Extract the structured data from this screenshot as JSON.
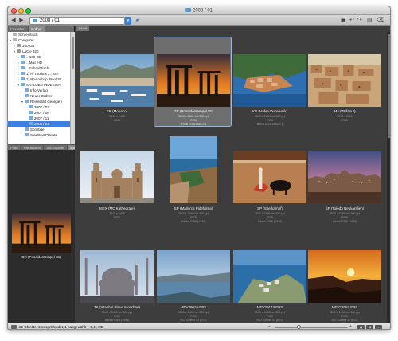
{
  "window": {
    "title": "2008 / 01"
  },
  "toolbar": {
    "path_value": "2008 / 01",
    "back_icon": "back-arrow-icon",
    "forward_icon": "forward-arrow-icon"
  },
  "sidebar": {
    "tabs": [
      "Favoriten",
      "Ordner"
    ],
    "tree": [
      {
        "label": "Schreibtisch",
        "level": 0,
        "icon": "desk",
        "tri": ""
      },
      {
        "label": "Computer",
        "level": 0,
        "icon": "desk",
        "tri": "▾"
      },
      {
        "label": "160 GB",
        "level": 1,
        "icon": "drive",
        "tri": "▸"
      },
      {
        "label": "LaCie 320",
        "level": 1,
        "icon": "drive",
        "tri": "▾"
      },
      {
        "label": ".. 160 GB",
        "level": 2,
        "icon": "folder",
        "tri": "▸"
      },
      {
        "label": ".. Mac HD",
        "level": 2,
        "icon": "folder",
        "tri": "▸"
      },
      {
        "label": ".. Schreibtisch",
        "level": 2,
        "icon": "folder",
        "tri": "▸"
      },
      {
        "label": "1) AI Toolbox 2...sch",
        "level": 2,
        "icon": "folder",
        "tri": "▸"
      },
      {
        "label": "2) Photoshop iPool Sz",
        "level": 2,
        "icon": "folder",
        "tri": "▸"
      },
      {
        "label": "SATZOBS INDESIGN",
        "level": 2,
        "icon": "folder",
        "tri": "▾"
      },
      {
        "label": "Info-Verlag",
        "level": 3,
        "icon": "folder",
        "tri": ""
      },
      {
        "label": "Neuer Ordner",
        "level": 3,
        "icon": "folder",
        "tri": ""
      },
      {
        "label": "Reiseblatt Georgien",
        "level": 3,
        "icon": "folder",
        "tri": "▾"
      },
      {
        "label": "2007 / 07",
        "level": 4,
        "icon": "folder",
        "tri": ""
      },
      {
        "label": "2007 / 08",
        "level": 4,
        "icon": "folder",
        "tri": ""
      },
      {
        "label": "2007 / 11",
        "level": 4,
        "icon": "folder",
        "tri": ""
      },
      {
        "label": "2008 / 01",
        "level": 4,
        "icon": "folder",
        "tri": "",
        "selected": true
      },
      {
        "label": "Sonstige",
        "level": 3,
        "icon": "folder",
        "tri": ""
      },
      {
        "label": "Stadtblut Plakate",
        "level": 3,
        "icon": "folder",
        "tri": ""
      }
    ],
    "preview_tabs": [
      "Filter",
      "Metadaten",
      "Stichwörter",
      "Vorschau"
    ],
    "preview_caption": "GR (Poseidontempel Sü)"
  },
  "main": {
    "tab_label": "Inhalt",
    "items": [
      {
        "title": "FR (Monaco)",
        "line1": "3543 x 2480",
        "line2": "RGB",
        "line3": "",
        "scene": "monaco"
      },
      {
        "title": "GR (Poseidontempel Sü)",
        "line1": "3543 x 2481 bei 300 ppi",
        "line2": "RGB",
        "line3": "sRGB IEC61966-2.1",
        "scene": "temple",
        "selected": true
      },
      {
        "title": "KR (Hafen Dubrovnik)",
        "line1": "3543 x 2480 bei 300 ppi",
        "line2": "RGB",
        "line3": "sRGB IEC61966-2.1",
        "scene": "dubrovnik"
      },
      {
        "title": "MA (Tarfaout)",
        "line1": "3543 x 2480",
        "line2": "RGB",
        "line3": "",
        "scene": "morocco"
      },
      {
        "title": "MEX (MC Kathedrale)",
        "line1": "3543 x 2480",
        "line2": "RGB",
        "line3": "",
        "scene": "cathedral"
      },
      {
        "title": "SP (Mallorca Pidefalma)",
        "line1": "3543 x 2480 bei 300 ppi",
        "line2": "RGB",
        "line3": "Adobe RGB (1998)",
        "scene": "mallorca"
      },
      {
        "title": "SP (Stierkampf)",
        "line1": "3543 x 2480 bei 300 ppi",
        "line2": "RGB",
        "line3": "Adobe RGB (1998)",
        "scene": "bullfight"
      },
      {
        "title": "SP (Toledo Neukantlien)",
        "line1": "3543 x 2480 bei 300 ppi",
        "line2": "RGB",
        "line3": "Adobe RGB (1998)",
        "scene": "toledo"
      },
      {
        "title": "TK (Istanbul Blaue Moschee)",
        "line1": "3543 x 2480 bei 300 ppi",
        "line2": "RGB",
        "line3": "Adobe RGB (1998)",
        "scene": "mosque"
      },
      {
        "title": "MEV28019.EPS",
        "line1": "3543 x 2480 bei 300 ppi",
        "line2": "RGB",
        "line3": "ISO Coated v2 (ECI)",
        "scene": "lake"
      },
      {
        "title": "MEV29143.EPS",
        "line1": "3543 x 2480 bei 300 ppi",
        "line2": "RGB",
        "line3": "ISO Coated v2 (ECI)",
        "scene": "coast"
      },
      {
        "title": "MEV32052.EPS",
        "line1": "3543 x 2480 bei 300 ppi",
        "line2": "RGB",
        "line3": "ISO Coated v2 (ECI)",
        "scene": "sunset"
      }
    ]
  },
  "status": {
    "text": "22 Objekte, 2 ausgeblendet, 1 ausgewählt – 6,41 MB"
  },
  "colors": {
    "selection": "#3d80df",
    "main_bg": "#3d3d3d",
    "sidebar_bg": "#2f2f2f"
  }
}
